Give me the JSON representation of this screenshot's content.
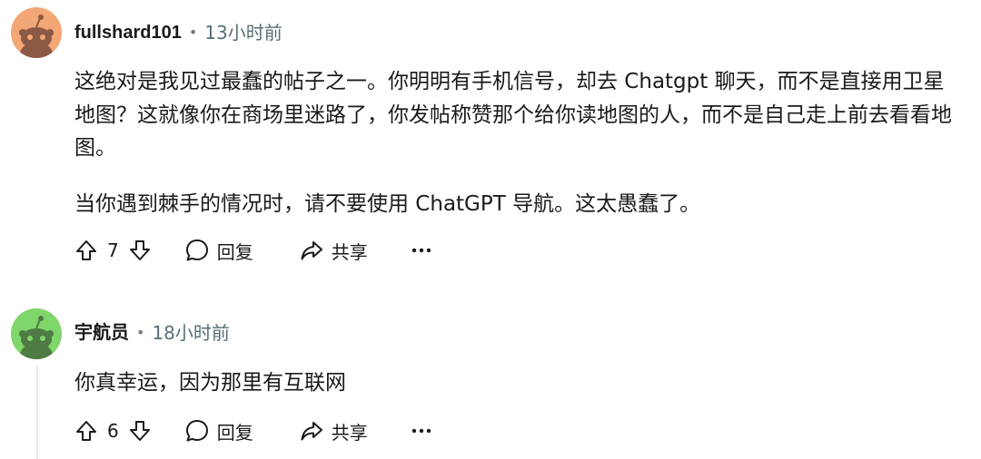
{
  "comments": [
    {
      "username": "fullshard101",
      "separator": "•",
      "time": "13小时前",
      "paragraphs": [
        "这绝对是我见过最蠢的帖子之一。你明明有手机信号，却去 Chatgpt 聊天，而不是直接用卫星地图？这就像你在商场里迷路了，你发帖称赞那个给你读地图的人，而不是自己走上前去看看地图。",
        "当你遇到棘手的情况时，请不要使用 ChatGPT 导航。这太愚蠢了。"
      ],
      "votes": "7",
      "reply_label": "回复",
      "share_label": "共享",
      "avatar_color": "#f3a676"
    },
    {
      "username": "宇航员",
      "separator": "•",
      "time": "18小时前",
      "paragraphs": [
        "你真幸运，因为那里有互联网"
      ],
      "votes": "6",
      "reply_label": "回复",
      "share_label": "共享",
      "avatar_color": "#7fd66b"
    }
  ],
  "icons": {
    "upvote": "arrow-up-icon",
    "downvote": "arrow-down-icon",
    "reply": "speech-bubble-icon",
    "share": "share-arrow-icon",
    "more": "ellipsis-icon"
  }
}
